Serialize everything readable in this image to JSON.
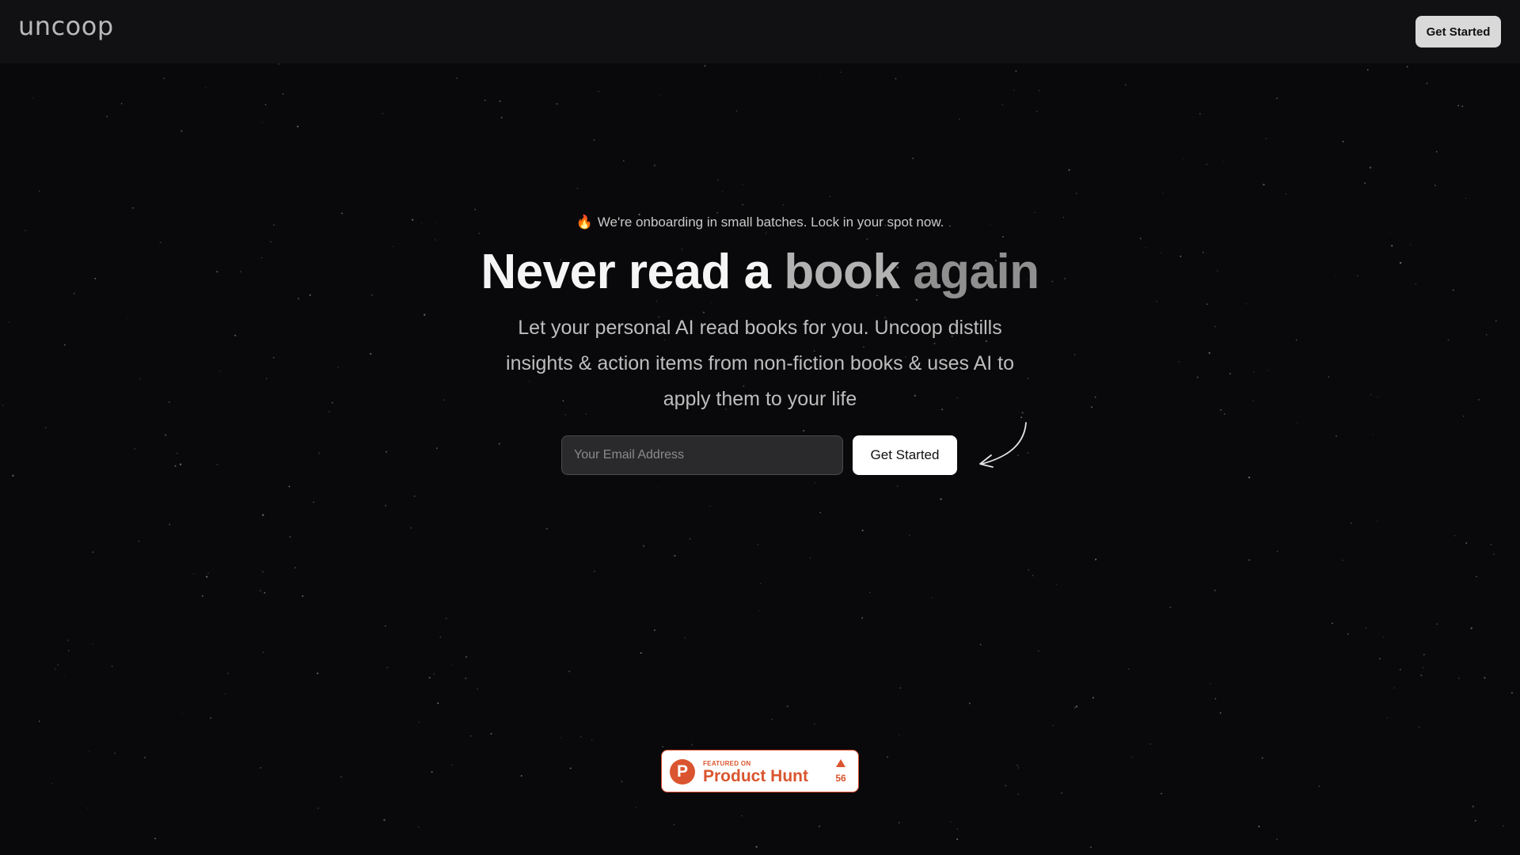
{
  "brand": {
    "logo_text": "uncoop"
  },
  "nav": {
    "cta_label": "Get Started"
  },
  "hero": {
    "notice_icon": "fire-icon",
    "notice_emoji": "🔥",
    "notice_text": "We're onboarding in small batches. Lock in your spot now.",
    "headline_part1": "Never read a",
    "headline_part2": "book",
    "headline_part3": "again",
    "subheadline": "Let your personal AI read books for you. Uncoop distills insights & action items from non-fiction books & uses AI to apply them to your life"
  },
  "signup": {
    "email_placeholder": "Your Email Address",
    "email_value": "",
    "cta_label": "Get Started",
    "arrow_icon": "curved-arrow-icon"
  },
  "product_hunt": {
    "logo_letter": "P",
    "featured_label": "FEATURED ON",
    "name": "Product Hunt",
    "upvote_icon": "upvote-triangle-icon",
    "upvote_count": "56"
  },
  "colors": {
    "background": "#09090b",
    "topbar": "#111113",
    "product_hunt_accent": "#da552f",
    "fire": "#f7861d"
  }
}
